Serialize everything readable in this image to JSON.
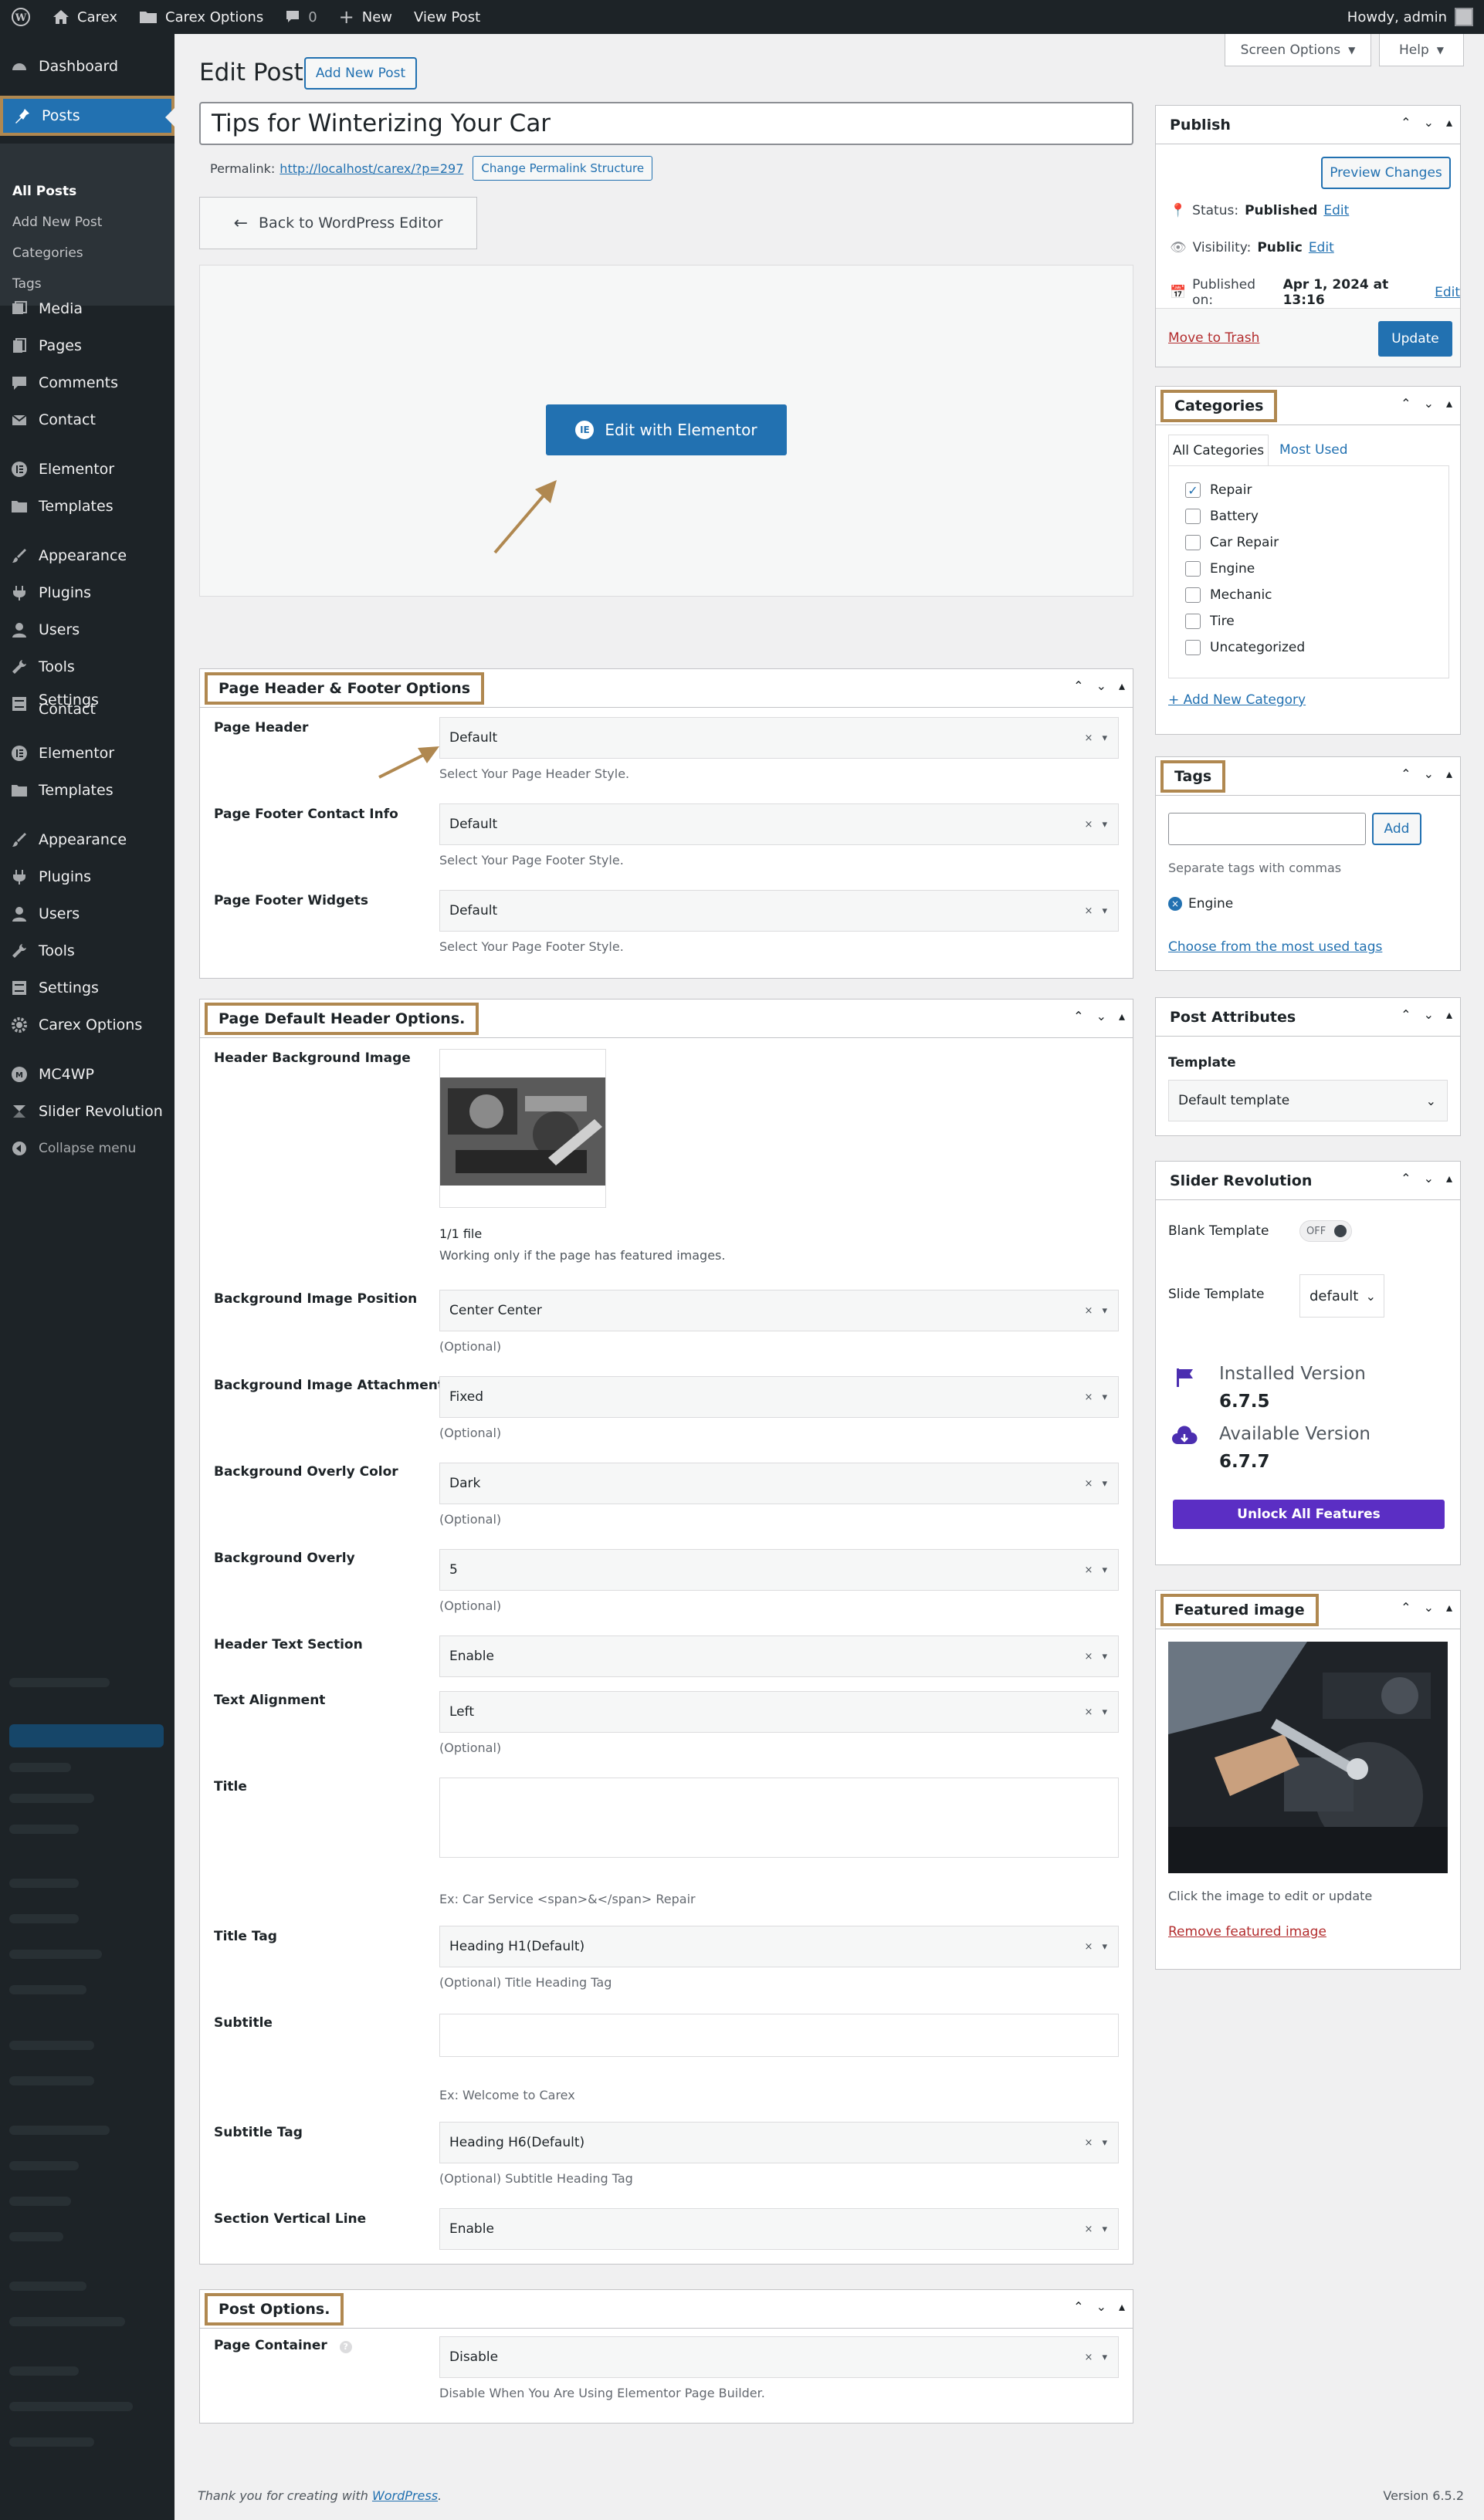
{
  "adminbar": {
    "site_name": "Carex",
    "options_label": "Carex Options",
    "comments_count": "0",
    "new_label": "New",
    "view_post_label": "View Post",
    "howdy": "Howdy, admin"
  },
  "sidebar": {
    "dashboard": "Dashboard",
    "posts": "Posts",
    "all_posts": "All Posts",
    "add_new_post": "Add New Post",
    "categories": "Categories",
    "tags": "Tags",
    "media": "Media",
    "pages": "Pages",
    "comments": "Comments",
    "contact": "Contact",
    "elementor": "Elementor",
    "templates": "Templates",
    "appearance": "Appearance",
    "plugins": "Plugins",
    "users": "Users",
    "tools": "Tools",
    "settings": "Settings",
    "settings_overlap": "Contact",
    "carex_options": "Carex Options",
    "mc4wp": "MC4WP",
    "slider_revolution": "Slider Revolution",
    "collapse_menu": "Collapse menu"
  },
  "header": {
    "title": "Edit Post",
    "add_new_post": "Add New Post",
    "screen_options": "Screen Options",
    "help": "Help"
  },
  "post": {
    "title": "Tips for Winterizing Your Car",
    "permalink_label": "Permalink:",
    "permalink_url": "http://localhost/carex/?p=297",
    "change_permalink": "Change Permalink Structure",
    "back_to_editor": "Back to WordPress Editor",
    "edit_with_elementor": "Edit with Elementor"
  },
  "header_footer_box": {
    "title": "Page Header & Footer Options",
    "rows": [
      {
        "label": "Page Header",
        "value": "Default",
        "hint": "Select Your Page Header Style."
      },
      {
        "label": "Page Footer Contact Info",
        "value": "Default",
        "hint": "Select Your Page Footer Style."
      },
      {
        "label": "Page Footer Widgets",
        "value": "Default",
        "hint": "Select Your Page Footer Style."
      }
    ]
  },
  "default_header_box": {
    "title": "Page Default Header Options.",
    "bg_image_label": "Header Background Image",
    "file_count": "1/1 file",
    "file_note": "Working only if the page has featured images.",
    "position_label": "Background Image Position",
    "position_value": "Center Center",
    "attachment_label": "Background Image Attachment",
    "attachment_value": "Fixed",
    "overlay_color_label": "Background Overly Color",
    "overlay_color_value": "Dark",
    "overlay_label": "Background Overly",
    "overlay_value": "5",
    "optional": "(Optional)",
    "text_section_label": "Header Text Section",
    "text_section_value": "Enable",
    "alignment_label": "Text Alignment",
    "alignment_value": "Left",
    "title_label": "Title",
    "title_example": "Ex: Car Service <span>&</span> Repair",
    "title_tag_label": "Title Tag",
    "title_tag_value": "Heading H1(Default)",
    "title_tag_hint": "(Optional) Title Heading Tag",
    "subtitle_label": "Subtitle",
    "subtitle_example": "Ex: Welcome to Carex",
    "subtitle_tag_label": "Subtitle Tag",
    "subtitle_tag_value": "Heading H6(Default)",
    "subtitle_tag_hint": "(Optional) Subtitle Heading Tag",
    "vertical_line_label": "Section Vertical Line",
    "vertical_line_value": "Enable"
  },
  "post_options_box": {
    "title": "Post Options.",
    "container_label": "Page Container",
    "container_value": "Disable",
    "container_hint": "Disable When You Are Using Elementor Page Builder."
  },
  "publish": {
    "title": "Publish",
    "preview": "Preview Changes",
    "status_label": "Status:",
    "status_value": "Published",
    "visibility_label": "Visibility:",
    "visibility_value": "Public",
    "published_label": "Published on:",
    "published_value": "Apr 1, 2024 at 13:16",
    "edit": "Edit",
    "trash": "Move to Trash",
    "update": "Update"
  },
  "categories": {
    "title": "Categories",
    "tab_all": "All Categories",
    "tab_used": "Most Used",
    "items": [
      {
        "name": "Repair",
        "checked": true
      },
      {
        "name": "Battery",
        "checked": false
      },
      {
        "name": "Car Repair",
        "checked": false
      },
      {
        "name": "Engine",
        "checked": false
      },
      {
        "name": "Mechanic",
        "checked": false
      },
      {
        "name": "Tire",
        "checked": false
      },
      {
        "name": "Uncategorized",
        "checked": false
      }
    ],
    "add_new": "+ Add New Category"
  },
  "tags": {
    "title": "Tags",
    "add": "Add",
    "note": "Separate tags with commas",
    "tag": "Engine",
    "choose": "Choose from the most used tags"
  },
  "attributes": {
    "title": "Post Attributes",
    "template_label": "Template",
    "template_value": "Default template"
  },
  "slider": {
    "title": "Slider Revolution",
    "blank_label": "Blank Template",
    "toggle": "OFF",
    "slide_label": "Slide Template",
    "slide_value": "default",
    "installed_label": "Installed Version",
    "installed_value": "6.7.5",
    "available_label": "Available Version",
    "available_value": "6.7.7",
    "unlock": "Unlock All Features"
  },
  "featured": {
    "title": "Featured image",
    "hint": "Click the image to edit or update",
    "remove": "Remove featured image"
  },
  "footer": {
    "thanks_prefix": "Thank you for creating with ",
    "wordpress": "WordPress",
    "thanks_suffix": ".",
    "version": "Version 6.5.2"
  }
}
